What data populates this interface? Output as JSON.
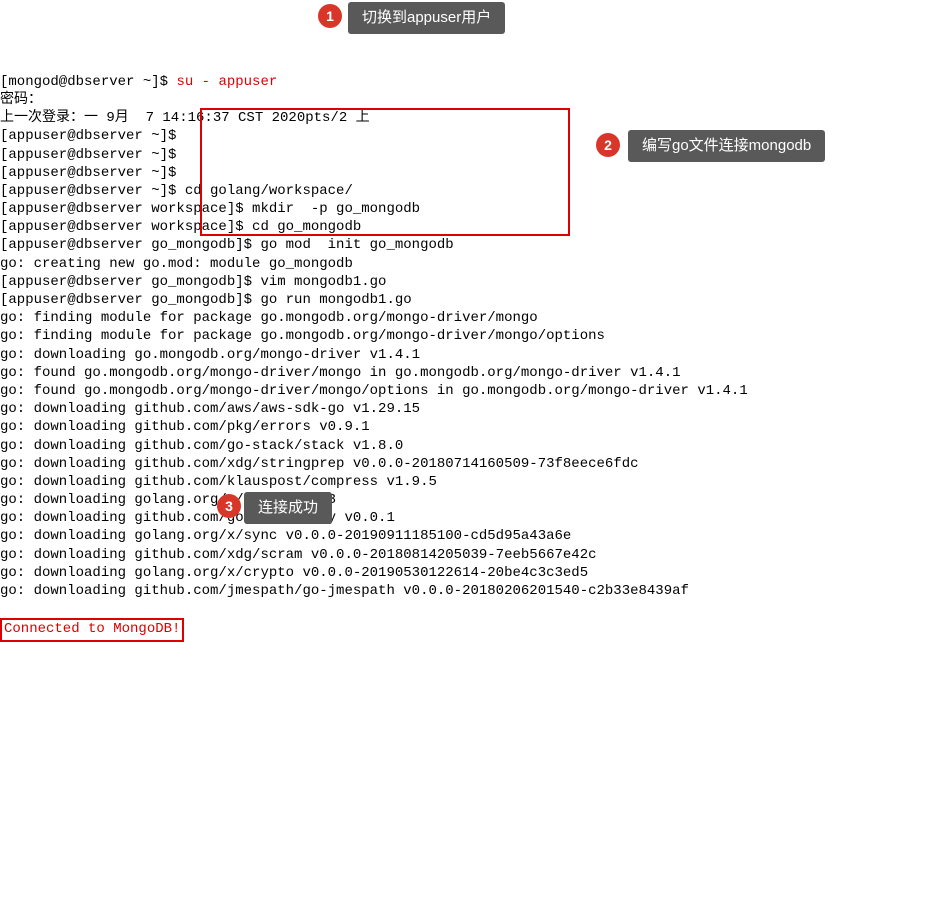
{
  "lines": [
    {
      "prompt": "[mongod@dbserver ~]$ ",
      "cmd": "su - appuser",
      "cmd_red": true
    },
    {
      "prompt": "",
      "cmd": "密码："
    },
    {
      "prompt": "",
      "cmd": "上一次登录：一 9月  7 14:16:37 CST 2020pts/2 上"
    },
    {
      "prompt": "[appuser@dbserver ~]$",
      "cmd": ""
    },
    {
      "prompt": "[appuser@dbserver ~]$",
      "cmd": ""
    },
    {
      "prompt": "[appuser@dbserver ~]$",
      "cmd": ""
    },
    {
      "prompt": "[appuser@dbserver ~]$ ",
      "cmd": "cd golang/workspace/"
    },
    {
      "prompt": "[appuser@dbserver workspace]$ ",
      "cmd": "mkdir  -p go_mongodb"
    },
    {
      "prompt": "[appuser@dbserver workspace]$ ",
      "cmd": "cd go_mongodb"
    },
    {
      "prompt": "[appuser@dbserver go_mongodb]$ ",
      "cmd": "go mod  init go_mongodb"
    },
    {
      "prompt": "",
      "cmd": "go: creating new go.mod: module go_mongodb"
    },
    {
      "prompt": "[appuser@dbserver go_mongodb]$ ",
      "cmd": "vim mongodb1.go"
    },
    {
      "prompt": "[appuser@dbserver go_mongodb]$ ",
      "cmd": "go run mongodb1.go"
    },
    {
      "prompt": "",
      "cmd": "go: finding module for package go.mongodb.org/mongo-driver/mongo"
    },
    {
      "prompt": "",
      "cmd": "go: finding module for package go.mongodb.org/mongo-driver/mongo/options"
    },
    {
      "prompt": "",
      "cmd": "go: downloading go.mongodb.org/mongo-driver v1.4.1"
    },
    {
      "prompt": "",
      "cmd": "go: found go.mongodb.org/mongo-driver/mongo in go.mongodb.org/mongo-driver v1.4.1"
    },
    {
      "prompt": "",
      "cmd": "go: found go.mongodb.org/mongo-driver/mongo/options in go.mongodb.org/mongo-driver v1.4.1"
    },
    {
      "prompt": "",
      "cmd": "go: downloading github.com/aws/aws-sdk-go v1.29.15"
    },
    {
      "prompt": "",
      "cmd": "go: downloading github.com/pkg/errors v0.9.1"
    },
    {
      "prompt": "",
      "cmd": "go: downloading github.com/go-stack/stack v1.8.0"
    },
    {
      "prompt": "",
      "cmd": "go: downloading github.com/xdg/stringprep v0.0.0-20180714160509-73f8eece6fdc"
    },
    {
      "prompt": "",
      "cmd": "go: downloading github.com/klauspost/compress v1.9.5"
    },
    {
      "prompt": "",
      "cmd": "go: downloading golang.org/x/text v0.3.3"
    },
    {
      "prompt": "",
      "cmd": "go: downloading github.com/golang/snappy v0.0.1"
    },
    {
      "prompt": "",
      "cmd": "go: downloading golang.org/x/sync v0.0.0-20190911185100-cd5d95a43a6e"
    },
    {
      "prompt": "",
      "cmd": "go: downloading github.com/xdg/scram v0.0.0-20180814205039-7eeb5667e42c"
    },
    {
      "prompt": "",
      "cmd": "go: downloading golang.org/x/crypto v0.0.0-20190530122614-20be4c3c3ed5"
    },
    {
      "prompt": "",
      "cmd": "go: downloading github.com/jmespath/go-jmespath v0.0.0-20180206201540-c2b33e8439af"
    }
  ],
  "result": "Connected to MongoDB!",
  "annotations": {
    "badge1": "1",
    "badge2": "2",
    "badge3": "3",
    "callout1": "切换到appuser用户",
    "callout2": "编写go文件连接mongodb",
    "callout3": "连接成功"
  }
}
